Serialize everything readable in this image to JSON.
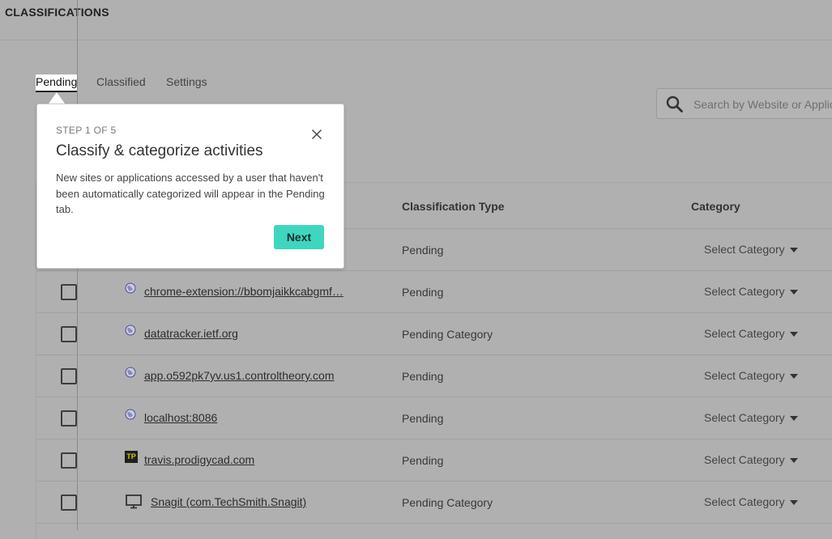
{
  "header": {
    "title": "CLASSIFICATIONS"
  },
  "tabs": [
    {
      "label": "Pending"
    },
    {
      "label": "Classified"
    },
    {
      "label": "Settings"
    }
  ],
  "search": {
    "placeholder": "Search by Website or Application"
  },
  "table": {
    "columns": {
      "classification_type": "Classification Type",
      "category": "Category"
    },
    "rows": [
      {
        "name": "",
        "type": "Pending",
        "category": "Select Category",
        "icon": "hidden"
      },
      {
        "name": "chrome-extension://bbomjaikkcabgmf…",
        "type": "Pending",
        "category": "Select Category",
        "icon": "globe-icon"
      },
      {
        "name": "datatracker.ietf.org",
        "type": "Pending Category",
        "category": "Select Category",
        "icon": "globe-icon"
      },
      {
        "name": "app.o592pk7yv.us1.controltheory.com",
        "type": "Pending",
        "category": "Select Category",
        "icon": "globe-icon"
      },
      {
        "name": "localhost:8086",
        "type": "Pending",
        "category": "Select Category",
        "icon": "globe-icon"
      },
      {
        "name": "travis.prodigycad.com",
        "type": "Pending",
        "category": "Select Category",
        "icon": "tp-favicon-icon",
        "icon_text": "TP"
      },
      {
        "name": "Snagit (com.TechSmith.Snagit)",
        "type": "Pending Category",
        "category": "Select Category",
        "icon": "monitor-icon"
      }
    ]
  },
  "popover": {
    "step": "STEP 1 OF 5",
    "title": "Classify & categorize activities",
    "body": "New sites or applications accessed by a user that haven't been automatically categorized will appear in the Pending tab.",
    "next_label": "Next"
  },
  "colors": {
    "accent": "#3fd6bf",
    "overlay": "#b0b0b0"
  }
}
